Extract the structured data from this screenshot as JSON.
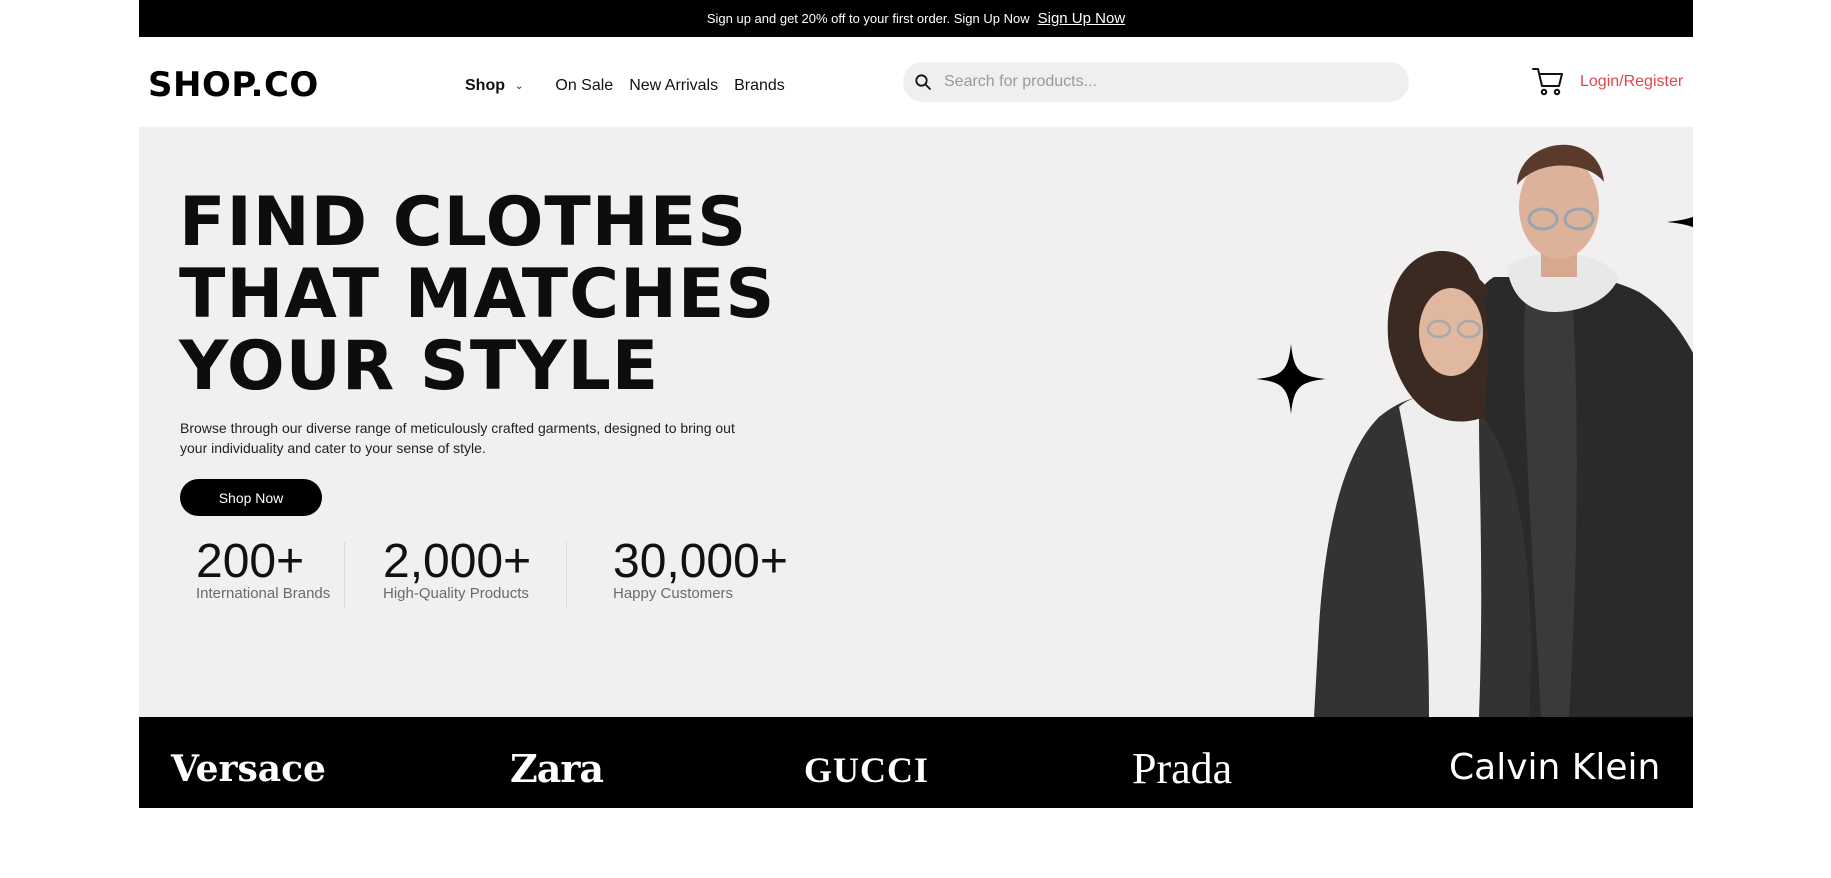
{
  "announcement": {
    "text": "Sign up and get 20% off to your first order. Sign Up Now",
    "link": "Sign Up Now"
  },
  "header": {
    "logo": "SHOP.CO",
    "nav": {
      "shop": "Shop",
      "on_sale": "On Sale",
      "new_arrivals": "New Arrivals",
      "brands": "Brands"
    },
    "search_placeholder": "Search for products...",
    "login": "Login/Register",
    "icons": [
      "search-icon",
      "cart-icon",
      "chevron-down-icon"
    ]
  },
  "hero": {
    "headline": [
      "FIND CLOTHES",
      "THAT MATCHES",
      "YOUR STYLE"
    ],
    "description_lines": [
      "Browse through our diverse range of meticulously crafted garments, designed to bring out",
      "your individuality and cater to your sense of style."
    ],
    "cta": "Shop Now",
    "stats": [
      {
        "value": "200+",
        "label": "International Brands"
      },
      {
        "value": "2,000+",
        "label": "High-Quality Products"
      },
      {
        "value": "30,000+",
        "label": "Happy Customers"
      }
    ]
  },
  "brands": [
    "Versace",
    "Zara",
    "GUCCI",
    "Prada",
    "Calvin Klein"
  ],
  "colors": {
    "topbar_bg": "#000000",
    "hero_bg": "#f1eff0",
    "login_accent": "#e0474c",
    "brands_bg": "#000000"
  }
}
